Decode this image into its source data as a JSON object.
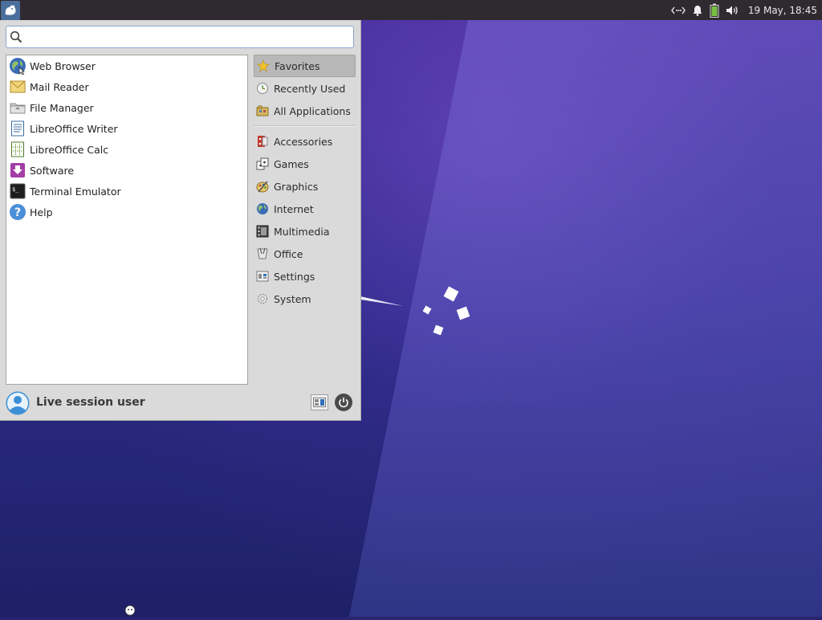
{
  "panel": {
    "clock": "19 May, 18:45",
    "tray_icons": [
      "network-icon",
      "notifications-icon",
      "battery-icon",
      "volume-icon"
    ],
    "colors": {
      "panel_bg": "#2f2a2f",
      "menu_button_bg": "#4a6f9c"
    }
  },
  "menu": {
    "search": {
      "value": "",
      "placeholder": ""
    },
    "favorites": [
      {
        "label": "Web Browser",
        "icon": "globe-icon"
      },
      {
        "label": "Mail Reader",
        "icon": "mail-icon"
      },
      {
        "label": "File Manager",
        "icon": "folder-icon"
      },
      {
        "label": "LibreOffice Writer",
        "icon": "writer-document-icon"
      },
      {
        "label": "LibreOffice Calc",
        "icon": "spreadsheet-icon"
      },
      {
        "label": "Software",
        "icon": "software-download-icon"
      },
      {
        "label": "Terminal Emulator",
        "icon": "terminal-icon"
      },
      {
        "label": "Help",
        "icon": "help-icon"
      }
    ],
    "categories_top": [
      {
        "label": "Favorites",
        "icon": "star-icon",
        "active": true
      },
      {
        "label": "Recently Used",
        "icon": "clock-icon"
      },
      {
        "label": "All Applications",
        "icon": "applications-folder-icon"
      }
    ],
    "categories": [
      {
        "label": "Accessories",
        "icon": "accessories-icon"
      },
      {
        "label": "Games",
        "icon": "games-icon"
      },
      {
        "label": "Graphics",
        "icon": "graphics-icon"
      },
      {
        "label": "Internet",
        "icon": "internet-globe-icon"
      },
      {
        "label": "Multimedia",
        "icon": "multimedia-icon"
      },
      {
        "label": "Office",
        "icon": "office-icon"
      },
      {
        "label": "Settings",
        "icon": "settings-icon"
      },
      {
        "label": "System",
        "icon": "system-gear-icon"
      }
    ],
    "user": {
      "name": "Live session user"
    },
    "colors": {
      "menu_bg": "#dadada",
      "list_bg": "#ffffff",
      "active_category_bg": "#b8b8b8",
      "search_border": "#87a7cf"
    }
  },
  "desktop": {
    "colors": {
      "top": "#3e2a96",
      "bottom": "#1d2066"
    }
  }
}
